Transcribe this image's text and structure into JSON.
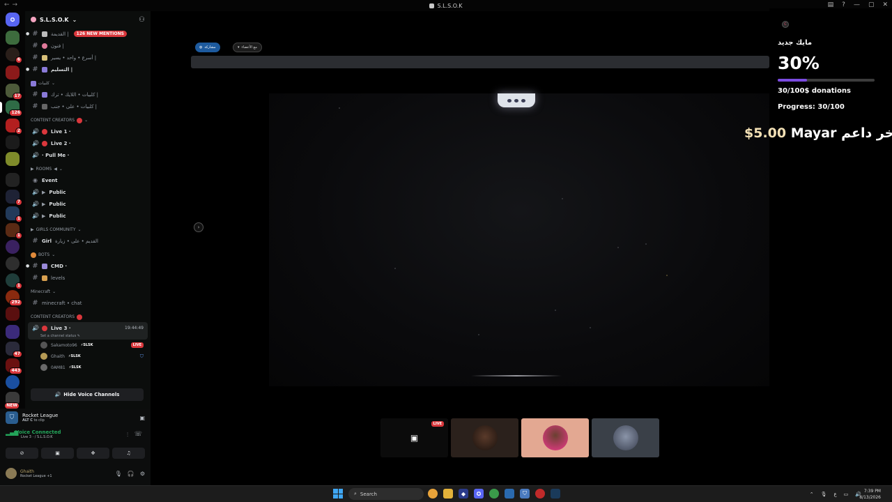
{
  "window": {
    "title": "S.L.S.O.K"
  },
  "server": {
    "name": "S.L.S.O.K"
  },
  "guild_badges": [
    "6",
    "17",
    "126",
    "2",
    "7",
    "1",
    "1",
    "1",
    "292",
    "47",
    "443",
    "NEW"
  ],
  "channels": {
    "top": [
      {
        "name": "القديمة | ",
        "mention": "126 NEW MENTIONS"
      },
      {
        "name": "فنون |"
      },
      {
        "name": "أسرع • واحد • يسير |"
      },
      {
        "name": "التسليم |"
      }
    ],
    "cat_kalbyat": "كلبيات",
    "kalbyat": [
      {
        "name": "كلبيات • اللايك • ترك |"
      },
      {
        "name": "كلبيات • على • جنب |"
      }
    ],
    "cat_creators": "CONTENT CREATORS",
    "creators": [
      {
        "name": "Live 1 ·"
      },
      {
        "name": "Live 2 ·"
      },
      {
        "name": "· Pull Me ·"
      }
    ],
    "cat_rooms": "ROOMS",
    "event": "Event",
    "rooms": [
      "Public",
      "Public",
      "Public"
    ],
    "cat_girls": "Girls Community",
    "girl": {
      "name": "Girl",
      "suffix": "القديم • على • زيارة"
    },
    "cat_bots": "BOTS",
    "bots": [
      {
        "name": "CMD ·"
      },
      {
        "name": "levels"
      }
    ],
    "cat_minecraft": "Minecraft",
    "minecraft": "minecraft • chat",
    "cat_creators2": "CONTENT CREATORS",
    "active_voice": {
      "name": "Live 3 ·",
      "timer": "19:44:49",
      "status": "Set a channel status"
    },
    "voice_users": [
      {
        "name": "Sakamoto96",
        "tag": "SLSK",
        "live": "LIVE"
      },
      {
        "name": "Ghaith",
        "tag": "SLSK"
      },
      {
        "name": "0AM81",
        "tag": "SLSK"
      }
    ],
    "hide_voice": "Hide Voice Channels"
  },
  "panel": {
    "activity_title": "Rocket League",
    "activity_hint_key1": "ALT",
    "activity_hint_key2": "C",
    "activity_hint": "to clip",
    "voice_title": "Voice Connected",
    "voice_sub": "Live 3 · / S.L.S.O.K",
    "user_name": "Ghaith",
    "user_status": "Rocket League +1"
  },
  "stage": {
    "share_label": "مشاركة",
    "members_label": "مع الأعضاء",
    "live_label": "LIVE"
  },
  "overlay": {
    "title": "مايك جديد",
    "percent": "30%",
    "progress_fraction": 0.3,
    "donations": "30/100$ donations",
    "progress": "Progress: 30/100",
    "supporter_label": "آخر داعم",
    "supporter_name": "Mayar",
    "supporter_amount": "$5.00"
  },
  "taskbar": {
    "search": "Search",
    "time": "7:39 PM",
    "date": "8/13/2026",
    "tray_lang": "ع"
  },
  "colors": {
    "accent": "#5865f2",
    "danger": "#da373c",
    "online": "#23a55a",
    "overlay_bar": "#7b4be0"
  }
}
